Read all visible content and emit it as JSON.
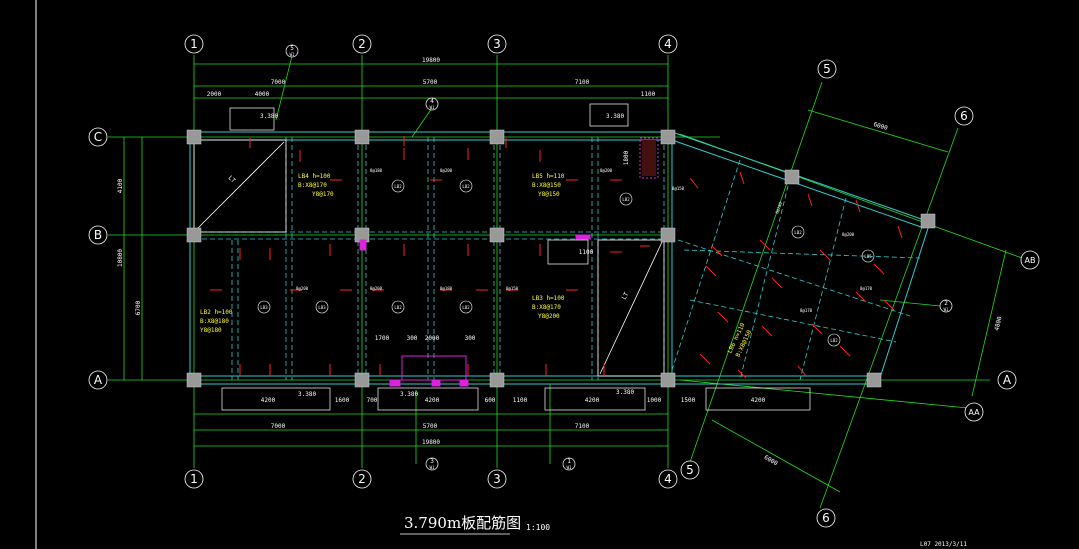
{
  "drawing": {
    "title": "3.790m板配筋图",
    "scale": "1:100",
    "sheet_code": "L07 2013/3/11",
    "colors": {
      "background": "#000000",
      "grid": "#22dd22",
      "wall": "#33cccc",
      "rebar": "#ff2222",
      "text": "#ffffff",
      "note": "#ffff33",
      "accent": "#dd22dd"
    }
  },
  "axes": {
    "vertical": [
      "1",
      "2",
      "3",
      "4"
    ],
    "horizontal": [
      "C",
      "B",
      "A"
    ],
    "skew_numbers": [
      "5",
      "6"
    ],
    "skew_letters": [
      "AB",
      "AA"
    ]
  },
  "dims": {
    "top_total": "19800",
    "top_spans": [
      "7000",
      "5700",
      "7100"
    ],
    "top_sub": [
      "2000",
      "4000",
      "1100"
    ],
    "left_spans": [
      "4100",
      "6700"
    ],
    "left_total": "10800",
    "bottom_total": "19800",
    "bottom_spans": [
      "7000",
      "5700",
      "7100"
    ],
    "bottom_sub": [
      "4200",
      "1600",
      "700",
      "4200",
      "600",
      "1100",
      "4200",
      "1000",
      "1500",
      "4200"
    ],
    "skew_top": "6000",
    "skew_bottom": "6000",
    "skew_right": "4800",
    "misc": [
      "1700",
      "300",
      "2000",
      "300",
      "1100",
      "1800"
    ]
  },
  "details": [
    "5",
    "4",
    "3",
    "1",
    "2"
  ],
  "detail_sub": "W1",
  "slab_notes": [
    {
      "id": "LB4",
      "line1": "LB4  h=100",
      "line2": "B:X8@170",
      "line3": "Y8@170"
    },
    {
      "id": "LB5",
      "line1": "LB5  h=110",
      "line2": "B:X8@150",
      "line3": "Y8@150"
    },
    {
      "id": "LB3",
      "line1": "LB3  h=100",
      "line2": "B:X8@170",
      "line3": "Y8@200"
    },
    {
      "id": "LB2",
      "line1": "LB2  h=100",
      "line2": "B:X8@180",
      "line3": "Y8@180"
    },
    {
      "id": "LB6",
      "line1": "LB6  h=110",
      "line2": "B:X8@150"
    }
  ],
  "slab_tags": [
    "LB2",
    "LB2",
    "LB2",
    "LB3",
    "LB3",
    "LB2",
    "LB2",
    "LB2",
    "LB5",
    "LB2"
  ],
  "rebar_tags": [
    "8@180",
    "8@200",
    "8@200",
    "8@150",
    "8@200",
    "8@200",
    "8@180",
    "8@150",
    "8@180",
    "8@200",
    "8@170",
    "8@170"
  ],
  "opening_tags": [
    "LT",
    "LT"
  ],
  "level_tags": [
    "3.380",
    "3.380",
    "3.380",
    "3.380",
    "3.380"
  ]
}
